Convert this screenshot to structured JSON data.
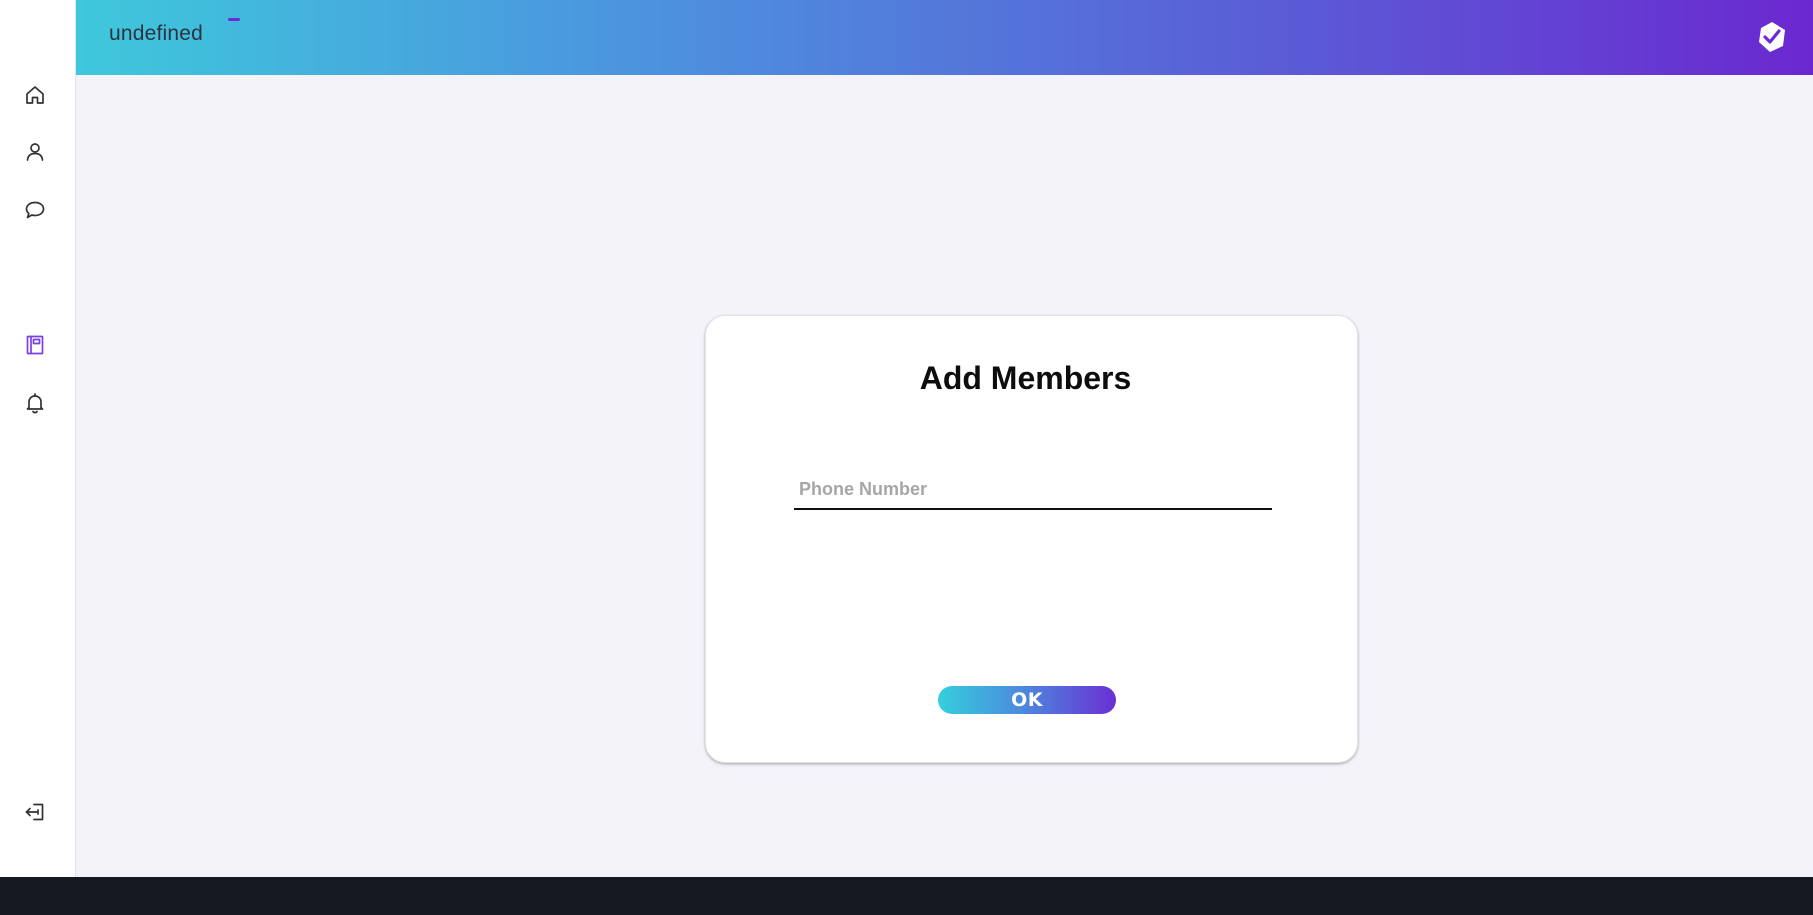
{
  "app": {
    "brand": "undefined"
  },
  "sidebar": {
    "items": [
      {
        "icon": "home-icon"
      },
      {
        "icon": "user-icon"
      },
      {
        "icon": "chat-bubble-icon"
      },
      {
        "icon": "notebook-icon",
        "active": true
      },
      {
        "icon": "bell-icon"
      }
    ],
    "logout_icon": "logout-icon"
  },
  "header": {
    "logo_icon": "check-badge-icon"
  },
  "dialog": {
    "title": "Add Members",
    "phone_placeholder": "Phone Number",
    "phone_value": "",
    "ok_label": "OK"
  },
  "colors": {
    "accent": "#6b2bd9",
    "gradient_start": "#3ec8dc",
    "gradient_end": "#6b28d0",
    "icon_default": "#333333",
    "icon_active": "#7b3fe4"
  }
}
